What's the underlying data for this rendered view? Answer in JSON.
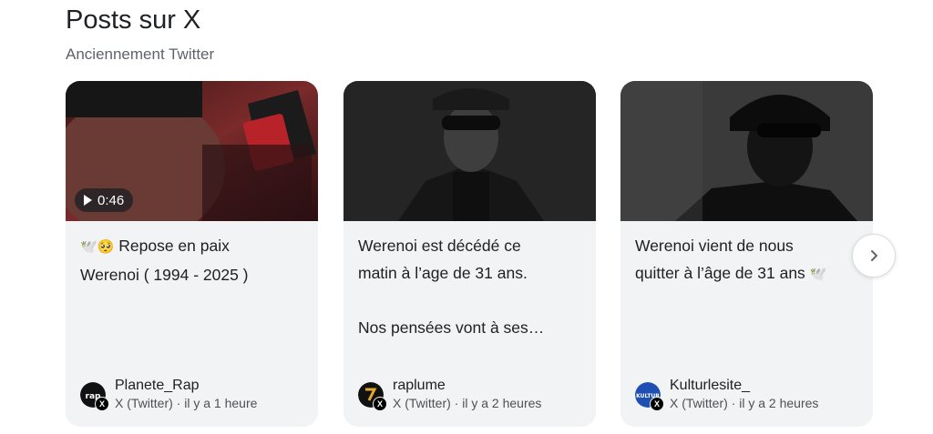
{
  "header": {
    "title": "Posts sur X",
    "subtitle": "Anciennement Twitter"
  },
  "posts": [
    {
      "has_video": true,
      "video_duration": "0:46",
      "emoji_prefix": "🕊️🥺",
      "text": "Repose en paix\nWerenoi ( 1994 - 2025 )",
      "author": "Planete_Rap",
      "source": "X (Twitter)",
      "time": "il y a 1 heure"
    },
    {
      "has_video": false,
      "text": "Werenoi est décédé ce\nmatin à l’age de 31 ans.\n\nNos pensées vont à ses…",
      "author": "raplume",
      "source": "X (Twitter)",
      "time": "il y a 2 heures"
    },
    {
      "has_video": false,
      "text": "Werenoi vient de nous\nquitter à l’âge de 31 ans",
      "emoji_suffix": "🕊️",
      "author": "Kulturlesite_",
      "source": "X (Twitter)",
      "time": "il y a 2 heures"
    }
  ],
  "meta_separator": "·",
  "icons": {
    "next": "chevron-right-icon",
    "play": "play-icon",
    "platform": "x-logo-icon"
  },
  "colors": {
    "card_bg": "#f1f3f4",
    "text": "#202124",
    "secondary_text": "#5f6368",
    "kulturlesite_avatar": "#1f4fb3"
  }
}
